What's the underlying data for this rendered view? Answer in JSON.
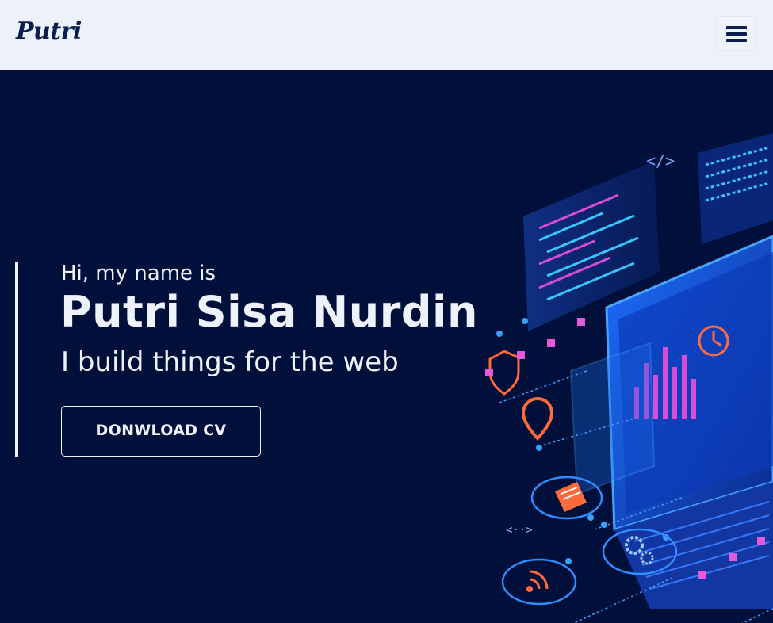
{
  "navbar": {
    "brand": "Putri",
    "menu_icon": "hamburger-menu-icon"
  },
  "hero": {
    "greeting": "Hi, my name is",
    "name": "Putri Sisa Nurdin",
    "tagline": "I build things for the web",
    "cta_label": "DONWLOAD CV",
    "illustration_code_tag": "</>",
    "illustration_icons": [
      "shield-icon",
      "clock-icon",
      "map-pin-icon",
      "document-icon",
      "rss-icon",
      "gears-icon",
      "laptop-icon"
    ]
  },
  "colors": {
    "navbar_bg": "#edf2fa",
    "hero_bg": "#00103a",
    "text_light": "#eef2fb",
    "brand_text": "#0a1f4d",
    "accent_blue": "#2f8dff",
    "accent_orange": "#ff6a3d",
    "accent_magenta": "#d94cd6"
  }
}
